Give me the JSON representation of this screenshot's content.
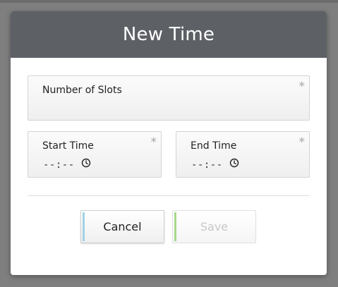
{
  "dialog": {
    "title": "New Time"
  },
  "fields": {
    "number_of_slots": {
      "label": "Number of Slots",
      "required_mark": "*",
      "value": ""
    },
    "start_time": {
      "label": "Start Time",
      "required_mark": "*",
      "value": "--:--",
      "icon": "clock-icon"
    },
    "end_time": {
      "label": "End Time",
      "required_mark": "*",
      "value": "--:--",
      "icon": "clock-icon"
    }
  },
  "buttons": {
    "cancel_label": "Cancel",
    "save_label": "Save",
    "save_enabled": false
  },
  "colors": {
    "header_bg": "#5d6166",
    "cancel_accent": "#9fd3e6",
    "save_accent": "#a6d98a",
    "backdrop": "#7f7f7f"
  }
}
